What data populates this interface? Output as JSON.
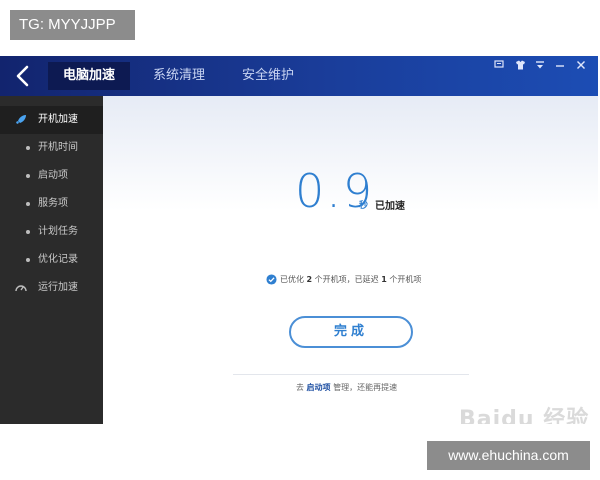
{
  "overlay": {
    "tag": "TG: MYYJJPP",
    "site_watermark": "www.ehuchina.com",
    "baidu_watermark": "Bai​du 经验"
  },
  "titlebar": {
    "tabs": [
      {
        "label": "电脑加速",
        "active": true
      },
      {
        "label": "系统清理",
        "active": false
      },
      {
        "label": "安全维护",
        "active": false
      }
    ],
    "controls": [
      "feedback-icon",
      "shirt-icon",
      "menu-icon",
      "minimize-icon",
      "close-icon"
    ]
  },
  "sidebar": {
    "items": [
      {
        "label": "开机加速",
        "active": true,
        "icon": "rocket-icon"
      },
      {
        "label": "开机时间"
      },
      {
        "label": "启动项"
      },
      {
        "label": "服务项"
      },
      {
        "label": "计划任务"
      },
      {
        "label": "优化记录"
      },
      {
        "label": "运行加速",
        "icon": "gauge-icon"
      }
    ]
  },
  "result": {
    "value": "0.9",
    "unit": "秒",
    "status": "已加速"
  },
  "summary": {
    "prefix": "已优化",
    "optimized_count": "2",
    "mid1": "个开机项，已延迟",
    "delayed_count": "1",
    "suffix": "个开机项"
  },
  "done_button": {
    "label": "完成"
  },
  "hint": {
    "prefix": "去",
    "link": "启动项",
    "suffix": "管理，还能再提速"
  },
  "colors": {
    "accent": "#2f7fd0",
    "titlebar": "#1a3d9a",
    "sidebar": "#2b2b2b"
  }
}
